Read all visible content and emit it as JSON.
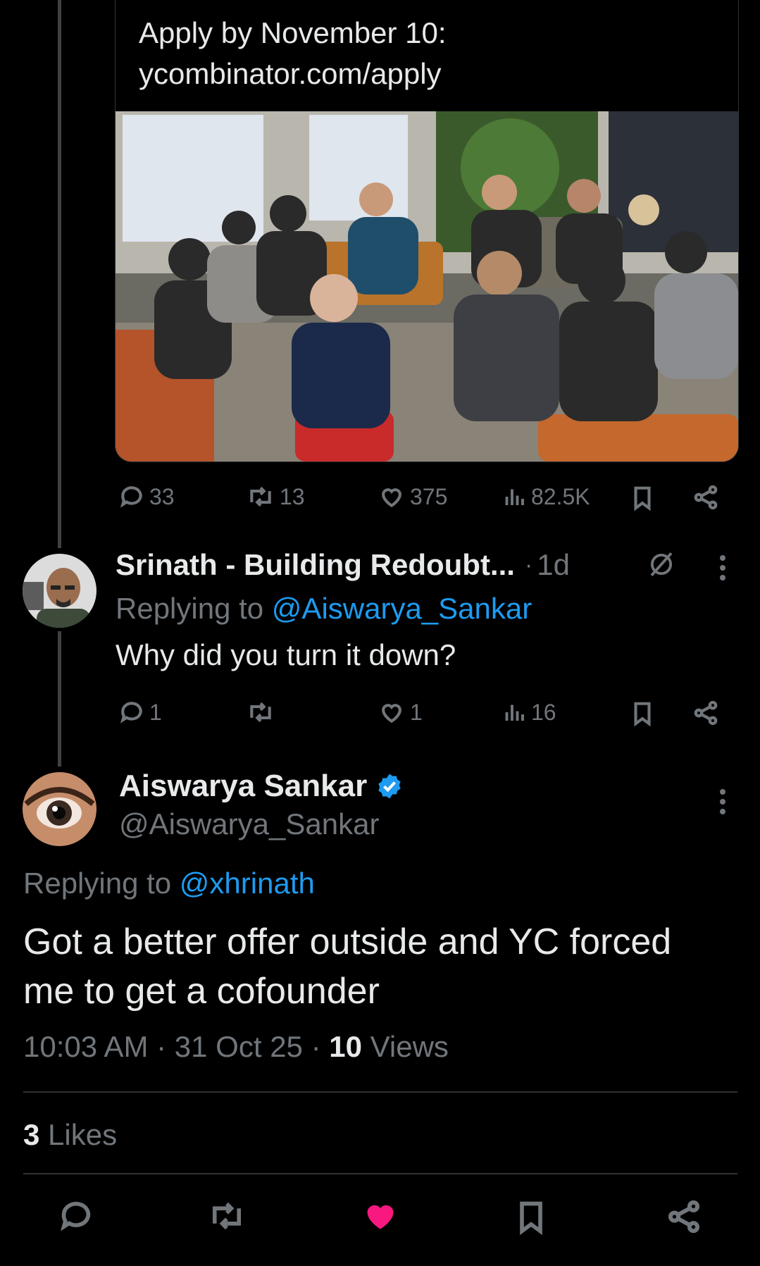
{
  "quoted": {
    "text_line1": "Apply by November 10:",
    "text_line2": "ycombinator.com/apply",
    "stats": {
      "replies": "33",
      "reposts": "13",
      "likes": "375",
      "views": "82.5K"
    }
  },
  "reply1": {
    "author": "Srinath - Building Redoubt...",
    "separator": "·",
    "time": "1d",
    "replying_prefix": "Replying to",
    "replying_handle": "@Aiswarya_Sankar",
    "text": "Why did you turn it down?",
    "stats": {
      "replies": "1",
      "reposts": "",
      "likes": "1",
      "views": "16"
    }
  },
  "main": {
    "author": "Aiswarya Sankar",
    "handle": "@Aiswarya_Sankar",
    "replying_prefix": "Replying to",
    "replying_handle": "@xhrinath",
    "text": "Got a better offer outside and YC forced me to get a cofounder",
    "time": "10:03 AM",
    "date": "31 Oct 25",
    "views_count": "10",
    "views_label": "Views",
    "likes_count": "3",
    "likes_label": "Likes"
  },
  "colors": {
    "accent": "#1d9bf0",
    "like_active": "#f91880",
    "muted": "#71767b"
  }
}
